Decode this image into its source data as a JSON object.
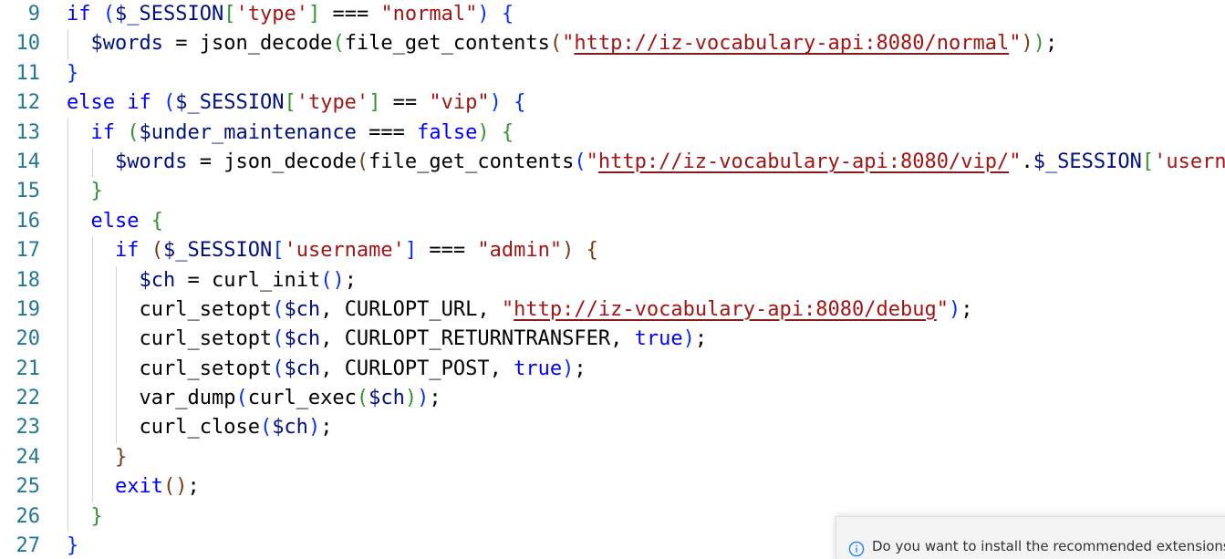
{
  "editor": {
    "line_numbers": [
      "9",
      "10",
      "11",
      "12",
      "13",
      "14",
      "15",
      "16",
      "17",
      "18",
      "19",
      "20",
      "21",
      "22",
      "23",
      "24",
      "25",
      "26",
      "27"
    ],
    "lines": [
      {
        "indent": 0,
        "tokens": [
          [
            "kw",
            "if"
          ],
          [
            "plain",
            " "
          ],
          [
            "b1",
            "("
          ],
          [
            "var",
            "$_SESSION"
          ],
          [
            "b2",
            "["
          ],
          [
            "str",
            "'type'"
          ],
          [
            "b2",
            "]"
          ],
          [
            "op",
            " === "
          ],
          [
            "str",
            "\"normal\""
          ],
          [
            "b1",
            ")"
          ],
          [
            "plain",
            " "
          ],
          [
            "b1",
            "{"
          ]
        ]
      },
      {
        "indent": 1,
        "tokens": [
          [
            "var",
            "$words"
          ],
          [
            "op",
            " = "
          ],
          [
            "fn",
            "json_decode"
          ],
          [
            "b2",
            "("
          ],
          [
            "fn",
            "file_get_contents"
          ],
          [
            "b3",
            "("
          ],
          [
            "str",
            "\""
          ],
          [
            "url",
            "http://iz-vocabulary-api:8080/normal"
          ],
          [
            "str",
            "\""
          ],
          [
            "b3",
            ")"
          ],
          [
            "b2",
            ")"
          ],
          [
            "plain",
            ";"
          ]
        ]
      },
      {
        "indent": 0,
        "tokens": [
          [
            "b1",
            "}"
          ]
        ]
      },
      {
        "indent": 0,
        "tokens": [
          [
            "kw",
            "else"
          ],
          [
            "plain",
            " "
          ],
          [
            "kw",
            "if"
          ],
          [
            "plain",
            " "
          ],
          [
            "b1",
            "("
          ],
          [
            "var",
            "$_SESSION"
          ],
          [
            "b2",
            "["
          ],
          [
            "str",
            "'type'"
          ],
          [
            "b2",
            "]"
          ],
          [
            "op",
            " == "
          ],
          [
            "str",
            "\"vip\""
          ],
          [
            "b1",
            ")"
          ],
          [
            "plain",
            " "
          ],
          [
            "b1",
            "{"
          ]
        ]
      },
      {
        "indent": 1,
        "tokens": [
          [
            "kw",
            "if"
          ],
          [
            "plain",
            " "
          ],
          [
            "b2",
            "("
          ],
          [
            "var",
            "$under_maintenance"
          ],
          [
            "op",
            " === "
          ],
          [
            "kw",
            "false"
          ],
          [
            "b2",
            ")"
          ],
          [
            "plain",
            " "
          ],
          [
            "b2",
            "{"
          ]
        ]
      },
      {
        "indent": 2,
        "tokens": [
          [
            "var",
            "$words"
          ],
          [
            "op",
            " = "
          ],
          [
            "fn",
            "json_decode"
          ],
          [
            "b3",
            "("
          ],
          [
            "fn",
            "file_get_contents"
          ],
          [
            "b1",
            "("
          ],
          [
            "str",
            "\""
          ],
          [
            "url",
            "http://iz-vocabulary-api:8080/vip/"
          ],
          [
            "str",
            "\""
          ],
          [
            "op",
            "."
          ],
          [
            "var",
            "$_SESSION"
          ],
          [
            "b2",
            "["
          ],
          [
            "str",
            "'userna"
          ]
        ]
      },
      {
        "indent": 1,
        "tokens": [
          [
            "b2",
            "}"
          ]
        ]
      },
      {
        "indent": 1,
        "tokens": [
          [
            "kw",
            "else"
          ],
          [
            "plain",
            " "
          ],
          [
            "b2",
            "{"
          ]
        ]
      },
      {
        "indent": 2,
        "tokens": [
          [
            "kw",
            "if"
          ],
          [
            "plain",
            " "
          ],
          [
            "b3",
            "("
          ],
          [
            "var",
            "$_SESSION"
          ],
          [
            "b1",
            "["
          ],
          [
            "str",
            "'username'"
          ],
          [
            "b1",
            "]"
          ],
          [
            "op",
            " === "
          ],
          [
            "str",
            "\"admin\""
          ],
          [
            "b3",
            ")"
          ],
          [
            "plain",
            " "
          ],
          [
            "b3",
            "{"
          ]
        ]
      },
      {
        "indent": 3,
        "tokens": [
          [
            "var",
            "$ch"
          ],
          [
            "op",
            " = "
          ],
          [
            "fn",
            "curl_init"
          ],
          [
            "b1",
            "()"
          ],
          [
            "plain",
            ";"
          ]
        ]
      },
      {
        "indent": 3,
        "tokens": [
          [
            "fn",
            "curl_setopt"
          ],
          [
            "b1",
            "("
          ],
          [
            "var",
            "$ch"
          ],
          [
            "plain",
            ", "
          ],
          [
            "const",
            "CURLOPT_URL"
          ],
          [
            "plain",
            ", "
          ],
          [
            "str",
            "\""
          ],
          [
            "url",
            "http://iz-vocabulary-api:8080/debug"
          ],
          [
            "str",
            "\""
          ],
          [
            "b1",
            ")"
          ],
          [
            "plain",
            ";"
          ]
        ]
      },
      {
        "indent": 3,
        "tokens": [
          [
            "fn",
            "curl_setopt"
          ],
          [
            "b1",
            "("
          ],
          [
            "var",
            "$ch"
          ],
          [
            "plain",
            ", "
          ],
          [
            "const",
            "CURLOPT_RETURNTRANSFER"
          ],
          [
            "plain",
            ", "
          ],
          [
            "kw",
            "true"
          ],
          [
            "b1",
            ")"
          ],
          [
            "plain",
            ";"
          ]
        ]
      },
      {
        "indent": 3,
        "tokens": [
          [
            "fn",
            "curl_setopt"
          ],
          [
            "b1",
            "("
          ],
          [
            "var",
            "$ch"
          ],
          [
            "plain",
            ", "
          ],
          [
            "const",
            "CURLOPT_POST"
          ],
          [
            "plain",
            ", "
          ],
          [
            "kw",
            "true"
          ],
          [
            "b1",
            ")"
          ],
          [
            "plain",
            ";"
          ]
        ]
      },
      {
        "indent": 3,
        "tokens": [
          [
            "fn",
            "var_dump"
          ],
          [
            "b1",
            "("
          ],
          [
            "fn",
            "curl_exec"
          ],
          [
            "b2",
            "("
          ],
          [
            "var",
            "$ch"
          ],
          [
            "b2",
            ")"
          ],
          [
            "b1",
            ")"
          ],
          [
            "plain",
            ";"
          ]
        ]
      },
      {
        "indent": 3,
        "tokens": [
          [
            "fn",
            "curl_close"
          ],
          [
            "b1",
            "("
          ],
          [
            "var",
            "$ch"
          ],
          [
            "b1",
            ")"
          ],
          [
            "plain",
            ";"
          ]
        ]
      },
      {
        "indent": 2,
        "tokens": [
          [
            "b3",
            "}"
          ]
        ]
      },
      {
        "indent": 2,
        "tokens": [
          [
            "kw",
            "exit"
          ],
          [
            "b3",
            "()"
          ],
          [
            "plain",
            ";"
          ]
        ]
      },
      {
        "indent": 1,
        "tokens": [
          [
            "b2",
            "}"
          ]
        ]
      },
      {
        "indent": 0,
        "tokens": [
          [
            "b1",
            "}"
          ]
        ]
      }
    ]
  },
  "notification": {
    "icon": "info-icon",
    "message": "Do you want to install the recommended extensions for"
  }
}
